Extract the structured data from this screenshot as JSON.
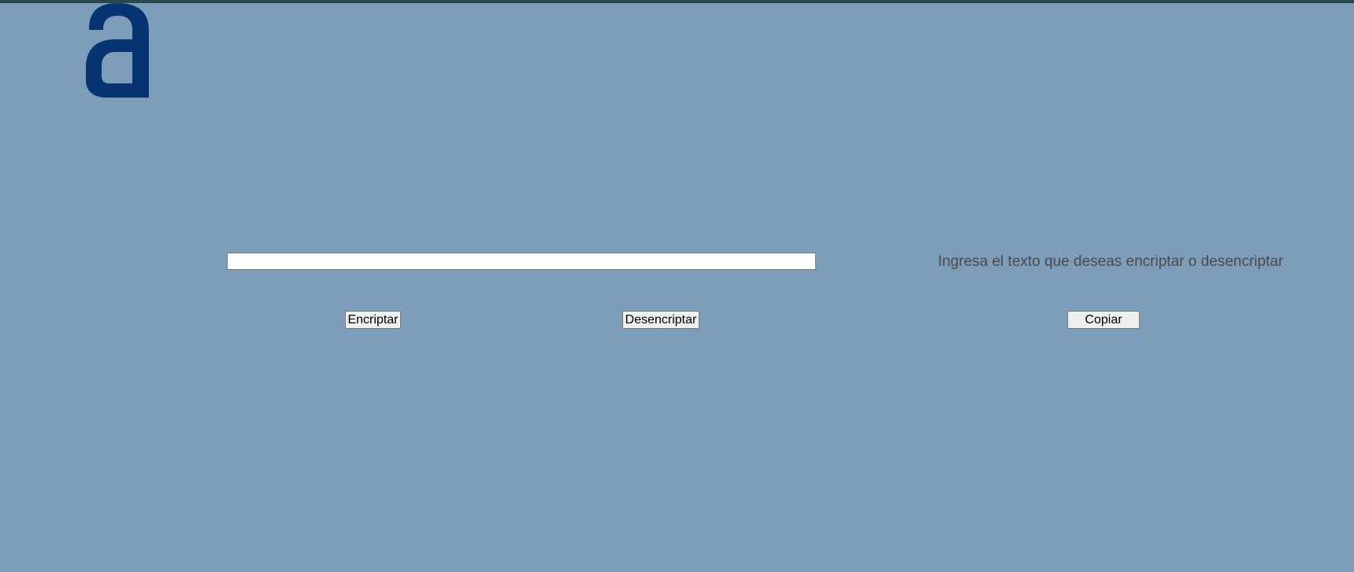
{
  "logo": {
    "icon": "alura-a-logo-icon",
    "letter": "a",
    "color": "#063473"
  },
  "input": {
    "value": "",
    "placeholder": ""
  },
  "output": {
    "message": "Ingresa el texto que deseas encriptar o desencriptar"
  },
  "buttons": {
    "encrypt_label": "Encriptar",
    "decrypt_label": "Desencriptar",
    "copy_label": "Copiar"
  },
  "colors": {
    "background": "#7e9dbb",
    "top_strip": "#2c4a4e",
    "output_text": "#4a4a4a"
  }
}
